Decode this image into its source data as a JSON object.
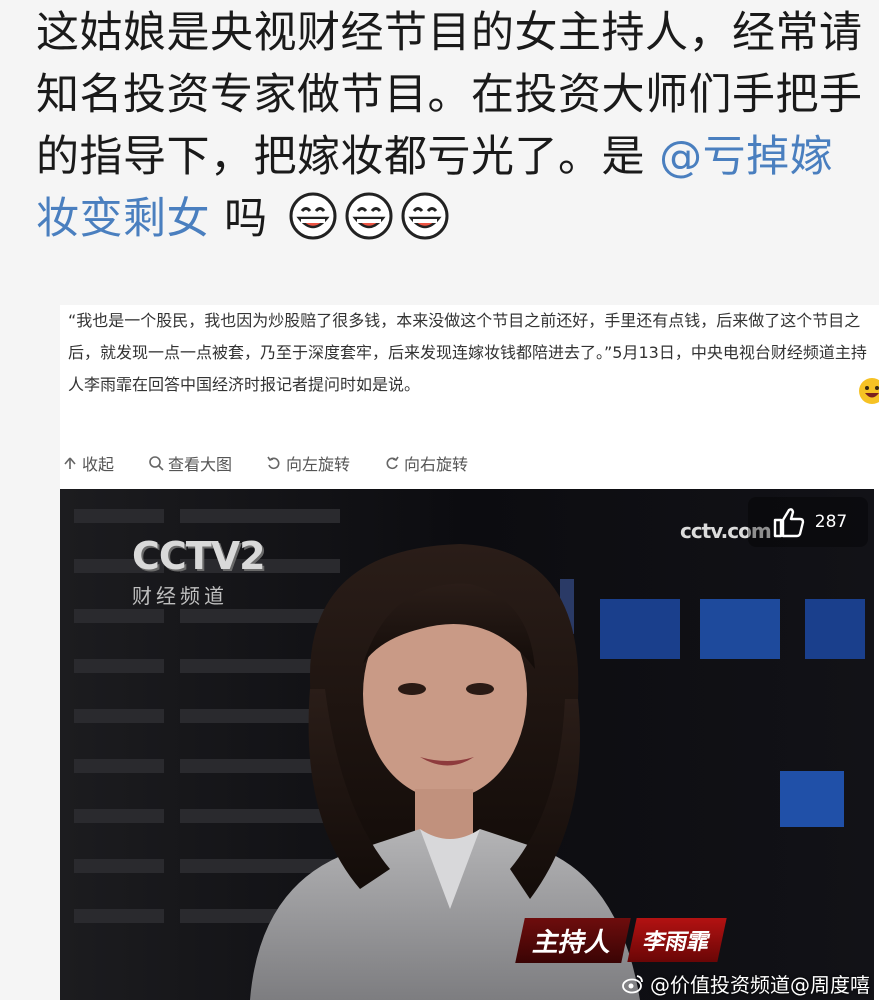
{
  "post": {
    "text_main": "这姑娘是央视财经节目的女主持人，经常请知名投资专家做节目。在投资大师们手把手的指导下，把嫁妆都亏光了。是 ",
    "mention": "@亏掉嫁妆变剩女",
    "text_tail": " 吗",
    "emoji_count": 3
  },
  "quote": {
    "text": "“我也是一个股民，我也因为炒股赔了很多钱，本来没做这个节目之前还好，手里还有点钱，后来做了这个节目之后，就发现一点一点被套，乃至于深度套牢，后来发现连嫁妆钱都陪进去了。”5月13日，中央电视台财经频道主持人李雨霏在回答中国经济时报记者提问时如是说。"
  },
  "toolbar": {
    "collapse": "收起",
    "view_large": "查看大图",
    "rotate_left": "向左旋转",
    "rotate_right": "向右旋转"
  },
  "video": {
    "channel_logo": "CCTV2",
    "channel_sub": "财经频道",
    "corner_logo": "cctv.com",
    "like_count": "287",
    "lower_third_title": "主持人",
    "lower_third_name": "李雨霏"
  },
  "watermark": {
    "text": "@价值投资频道@周度嘻"
  },
  "colors": {
    "mention": "#4a7fbf",
    "lower_third": "#8b0a0a"
  }
}
